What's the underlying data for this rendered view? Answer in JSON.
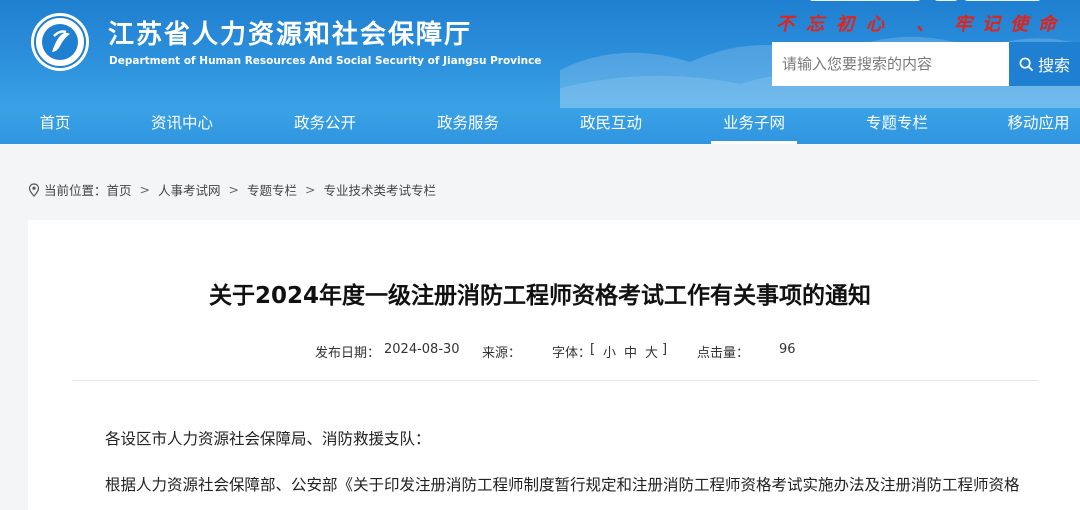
{
  "header": {
    "title_cn": "江苏省人力资源和社会保障厅",
    "title_en": "Department of Human Resources And Social Security of Jiangsu Province",
    "slogan": [
      "不",
      "忘",
      "初",
      "心",
      "、",
      "牢",
      "记",
      "使",
      "命"
    ],
    "brand_color": "#1f7fd0",
    "slogan_color": "#e2231a"
  },
  "search": {
    "placeholder": "请输入您要搜索的内容",
    "button_label": "搜索",
    "button_icon": "search-icon"
  },
  "nav": {
    "items": [
      "首页",
      "资讯中心",
      "政务公开",
      "政务服务",
      "政民互动",
      "业务子网",
      "专题专栏",
      "移动应用"
    ],
    "active": "业务子网"
  },
  "breadcrumb": {
    "prefix": "当前位置：",
    "icon": "location-pin-icon",
    "items": [
      "首页",
      "人事考试网",
      "专题专栏",
      "专业技术类考试专栏"
    ]
  },
  "article": {
    "title": "关于2024年度一级注册消防工程师资格考试工作有关事项的通知",
    "date_label": "发布日期：",
    "date": "2024-08-30",
    "source_label": "来源：",
    "font_label": "字体：",
    "font_open": "[",
    "font_small": "小",
    "font_medium": "中",
    "font_large": "大",
    "font_close": "]",
    "views_label": "点击量：",
    "views": "96",
    "paragraph_1": "各设区市人力资源社会保障局、消防救援支队：",
    "paragraph_2": "根据人力资源社会保障部、公安部《关于印发注册消防工程师制度暂行规定和注册消防工程师资格考试实施办法及注册消防工程师资格"
  }
}
